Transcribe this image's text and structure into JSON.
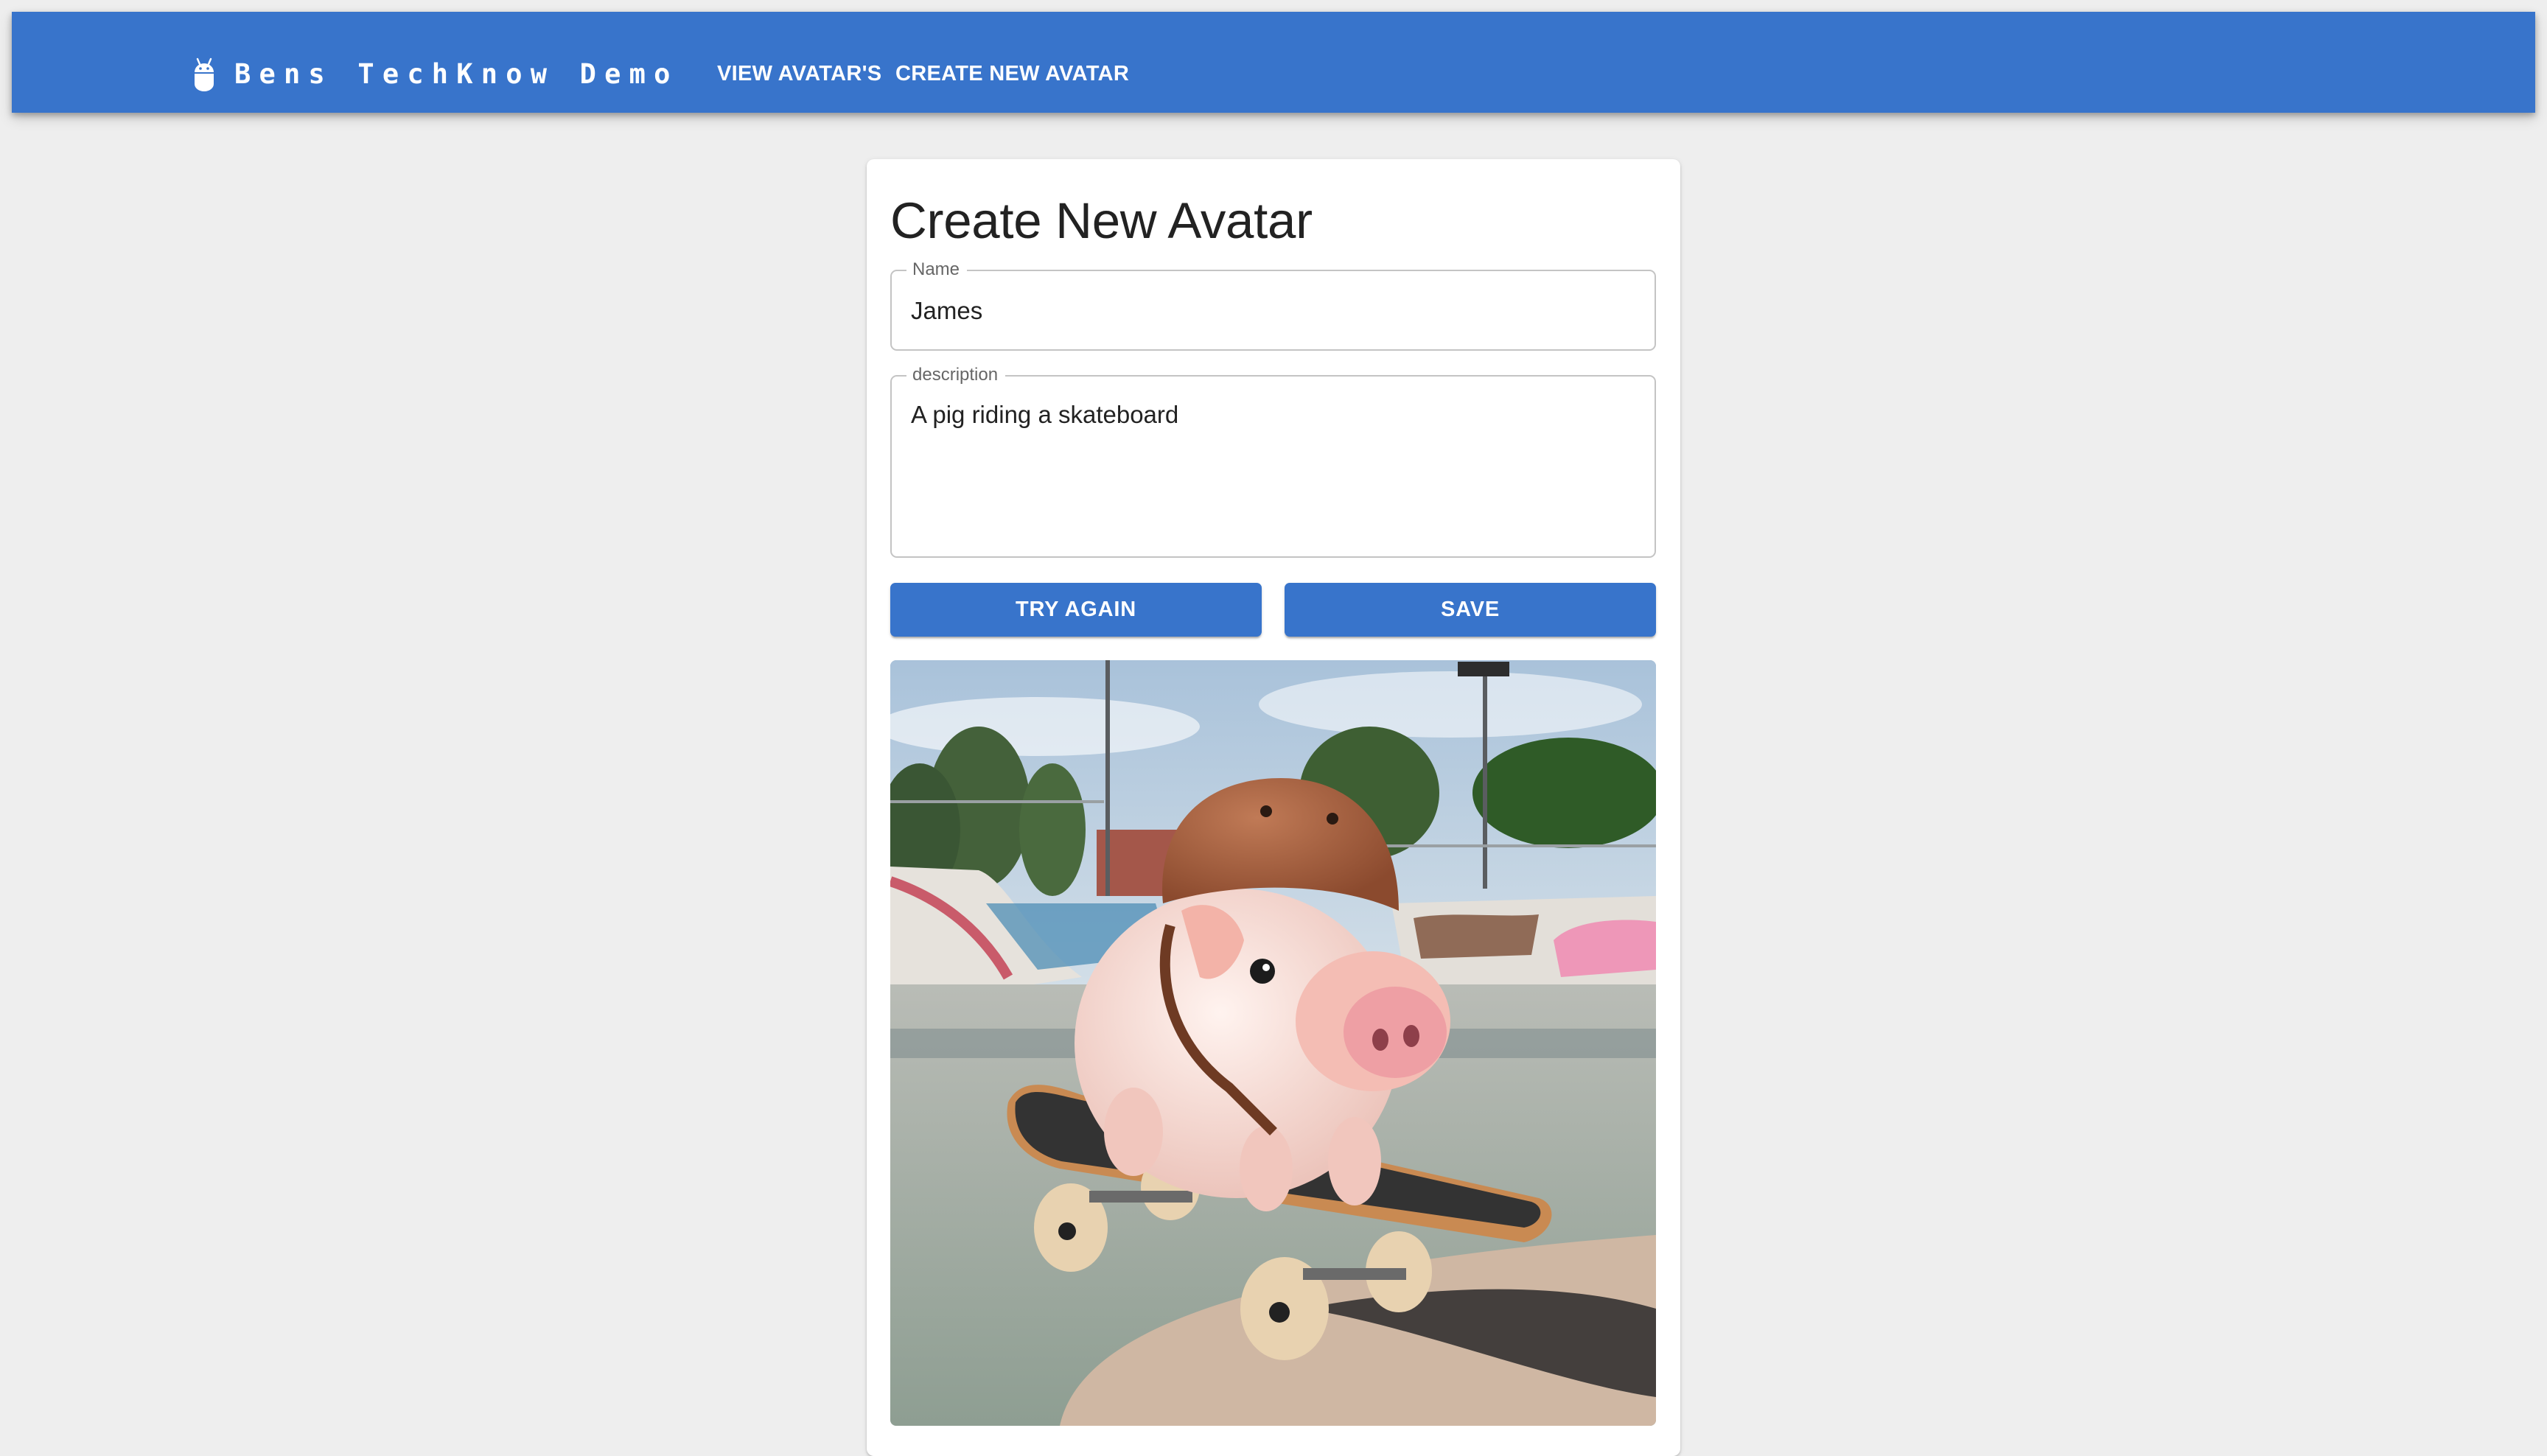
{
  "app": {
    "logo_icon": "android-robot-icon",
    "title": "Bens TechKnow Demo",
    "brand_color": "#3874cb"
  },
  "nav": {
    "items": [
      {
        "label": "VIEW AVATAR'S"
      },
      {
        "label": "CREATE NEW AVATAR"
      }
    ]
  },
  "form": {
    "title": "Create New Avatar",
    "name_field": {
      "label": "Name",
      "value": "James"
    },
    "description_field": {
      "label": "description",
      "value": "A pig riding a skateboard"
    },
    "buttons": {
      "try_again": "TRY AGAIN",
      "save": "SAVE"
    },
    "generated_image": {
      "alt": "A piglet wearing a brown helmet riding a skateboard in a graffiti skatepark"
    }
  }
}
